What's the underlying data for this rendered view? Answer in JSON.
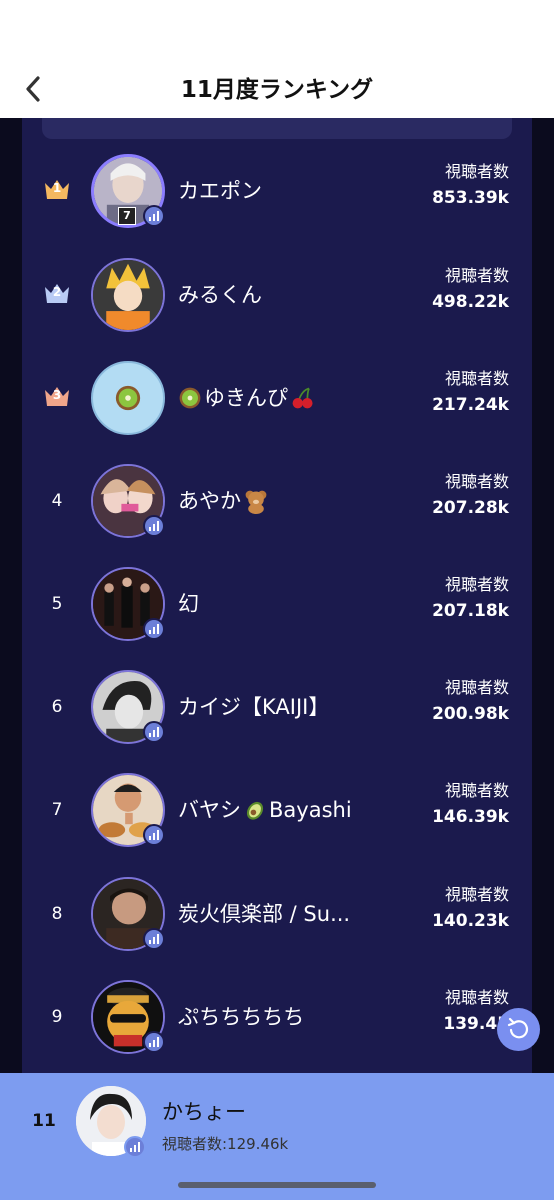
{
  "header": {
    "title": "11月度ランキング"
  },
  "colors": {
    "panel": "#1b1a4d",
    "background": "#0b0b1e",
    "footer": "#7d9cf0",
    "gold": "#f4b860",
    "silver": "#b9cbf5",
    "bronze": "#f0a58a"
  },
  "rankings": [
    {
      "rank": "1",
      "name": "カエポン",
      "emoji": "",
      "stat_label": "視聴者数",
      "stat_value": "853.39k"
    },
    {
      "rank": "2",
      "name": "みるくん",
      "emoji": "",
      "stat_label": "視聴者数",
      "stat_value": "498.22k"
    },
    {
      "rank": "3",
      "name": "ゆきんぴ",
      "emoji": "",
      "stat_label": "視聴者数",
      "stat_value": "217.24k"
    },
    {
      "rank": "4",
      "name": "あやか",
      "emoji": "",
      "stat_label": "視聴者数",
      "stat_value": "207.28k"
    },
    {
      "rank": "5",
      "name": "幻",
      "emoji": "",
      "stat_label": "視聴者数",
      "stat_value": "207.18k"
    },
    {
      "rank": "6",
      "name": "カイジ【KAIJI】",
      "emoji": "",
      "stat_label": "視聴者数",
      "stat_value": "200.98k"
    },
    {
      "rank": "7",
      "name": "バヤシ",
      "name_suffix": "Bayashi",
      "stat_label": "視聴者数",
      "stat_value": "146.39k"
    },
    {
      "rank": "8",
      "name": "炭火倶楽部 / Su...",
      "emoji": "",
      "stat_label": "視聴者数",
      "stat_value": "140.23k"
    },
    {
      "rank": "9",
      "name": "ぷちちちちち",
      "emoji": "",
      "stat_label": "視聴者数",
      "stat_value": "139.45"
    }
  ],
  "avatar_badge": "7",
  "footer": {
    "rank": "11",
    "name": "かちょー",
    "stat": "視聴者数:129.46k"
  }
}
